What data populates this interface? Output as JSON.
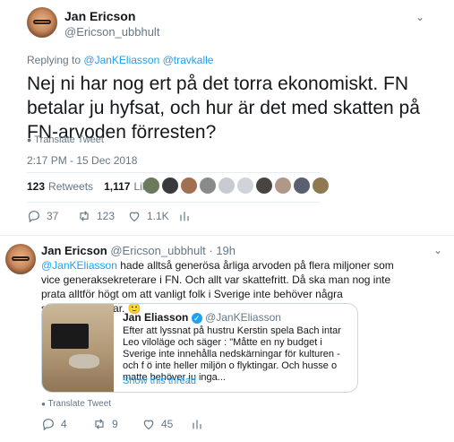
{
  "main_tweet": {
    "author_name": "Jan Ericson",
    "author_handle": "@Ericson_ubbhult",
    "replying_prefix": "Replying to",
    "replying_handles": "@JanKEliasson @travkalle",
    "text": "Nej ni har nog ert på det torra ekonomiskt. FN betalar ju hyfsat, och hur är det med skatten på FN-arvoden förresten?",
    "translate": "Translate Tweet",
    "timestamp": "2:17 PM - 15 Dec 2018",
    "retweets_count": "123",
    "retweets_label": "Retweets",
    "likes_count": "1,117",
    "likes_label": "Likes",
    "actions": {
      "reply": "37",
      "retweet": "123",
      "like": "1.1K"
    }
  },
  "reply_tweet": {
    "author_name": "Jan Ericson",
    "author_handle": "@Ericson_ubbhult",
    "time": "· 19h",
    "mention": "@JanKEliasson",
    "text": "hade alltså generösa årliga arvoden på flera miljoner som vice generaksekreterare i FN. Och allt var skattefritt. Då ska man nog inte prata alltför högt om att vanligt folk i Sverige inte behöver några skattesänkningar.",
    "emoji": "🙂",
    "quote": {
      "author_name": "Jan Eliasson",
      "author_handle": "@JanKEliasson",
      "text": "Efter att lyssnat på hustru Kerstin spela Bach intar Leo viloläge och säger : \"Måtte en ny budget i Sverige inte innehålla nedskärningar för kulturen - och f ö inte heller miljön o flyktingar. Och husse o matte behöver ju inga...",
      "show_thread": "Show this thread"
    },
    "translate": "Translate Tweet",
    "actions": {
      "reply": "4",
      "retweet": "9",
      "like": "45"
    }
  },
  "colors": {
    "accent": "#1da1f2",
    "muted": "#657786",
    "border": "#e6ecf0"
  }
}
